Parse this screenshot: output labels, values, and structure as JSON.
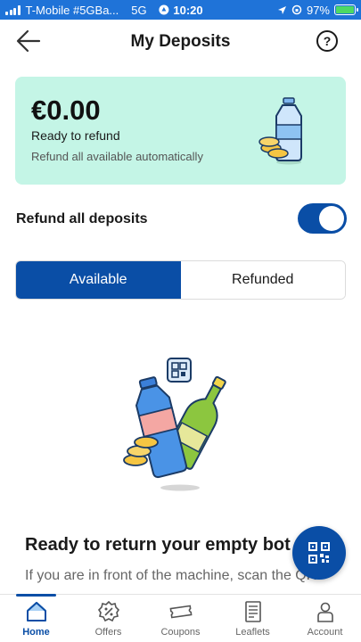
{
  "status_bar": {
    "carrier": "T-Mobile #5GBa...",
    "network": "5G",
    "time": "10:20",
    "battery": "97%"
  },
  "header": {
    "title": "My Deposits",
    "help_label": "?"
  },
  "balance": {
    "amount": "€0.00",
    "label": "Ready to refund",
    "sub": "Refund all available automatically"
  },
  "toggle": {
    "label": "Refund all deposits",
    "enabled": true
  },
  "tabs": [
    {
      "label": "Available",
      "active": true
    },
    {
      "label": "Refunded",
      "active": false
    }
  ],
  "empty_state": {
    "title": "Ready to return your empty bot",
    "description": "If you are in front of the machine, scan the QR"
  },
  "nav": [
    {
      "label": "Home",
      "icon": "home-icon",
      "active": true
    },
    {
      "label": "Offers",
      "icon": "offers-icon",
      "active": false
    },
    {
      "label": "Coupons",
      "icon": "coupon-icon",
      "active": false
    },
    {
      "label": "Leaflets",
      "icon": "leaflet-icon",
      "active": false
    },
    {
      "label": "Account",
      "icon": "account-icon",
      "active": false
    }
  ],
  "colors": {
    "primary": "#0a4ea6",
    "card_bg": "#c4f5e6",
    "status_bar": "#1f73d8"
  }
}
